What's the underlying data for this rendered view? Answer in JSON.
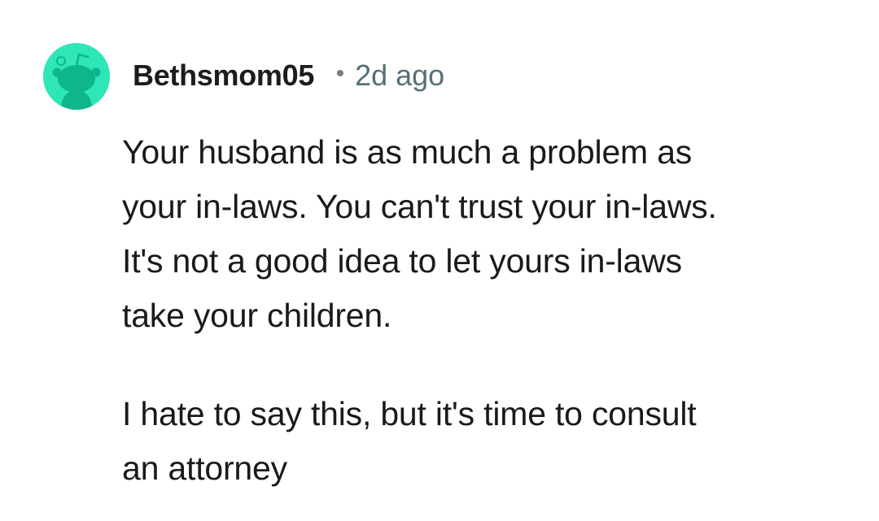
{
  "comment": {
    "author": "Bethsmom05",
    "separator": "•",
    "age": "2d ago",
    "avatar_icon": "snoo-avatar-icon",
    "avatar_color": "#2EE6B7",
    "paragraphs": [
      "Your husband is as much a problem as\nyour in-laws. You can't trust your in-laws.\nIt's not a good idea to let yours in-laws\ntake your children.",
      "I hate to say this, but it's time to consult\nan attorney"
    ]
  }
}
